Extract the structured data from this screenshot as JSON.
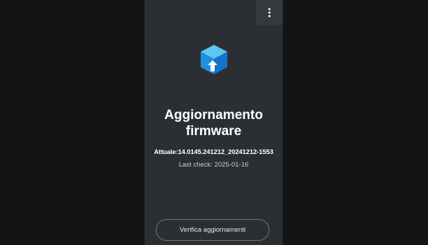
{
  "menu": {
    "icon": "more-vert-icon"
  },
  "logo": {
    "icon": "firmware-update-cube-icon",
    "colors": {
      "top": "#5cc7f5",
      "left": "#1f8fe0",
      "right": "#1574c9",
      "arrow": "#ffffff"
    }
  },
  "title": {
    "line1": "Aggiornamento",
    "line2": "firmware"
  },
  "current_version": {
    "text": "Attuale:14.0145.241212_20241212-1553"
  },
  "last_check": {
    "text": "Last check: 2025-01-16"
  },
  "check_button": {
    "label": "Verifica aggiornamenti"
  },
  "colors": {
    "background": "#141414",
    "screen": "#2b2f33",
    "text": "#ffffff",
    "muted_text": "#c8cbce",
    "button_border": "#6f7478"
  }
}
